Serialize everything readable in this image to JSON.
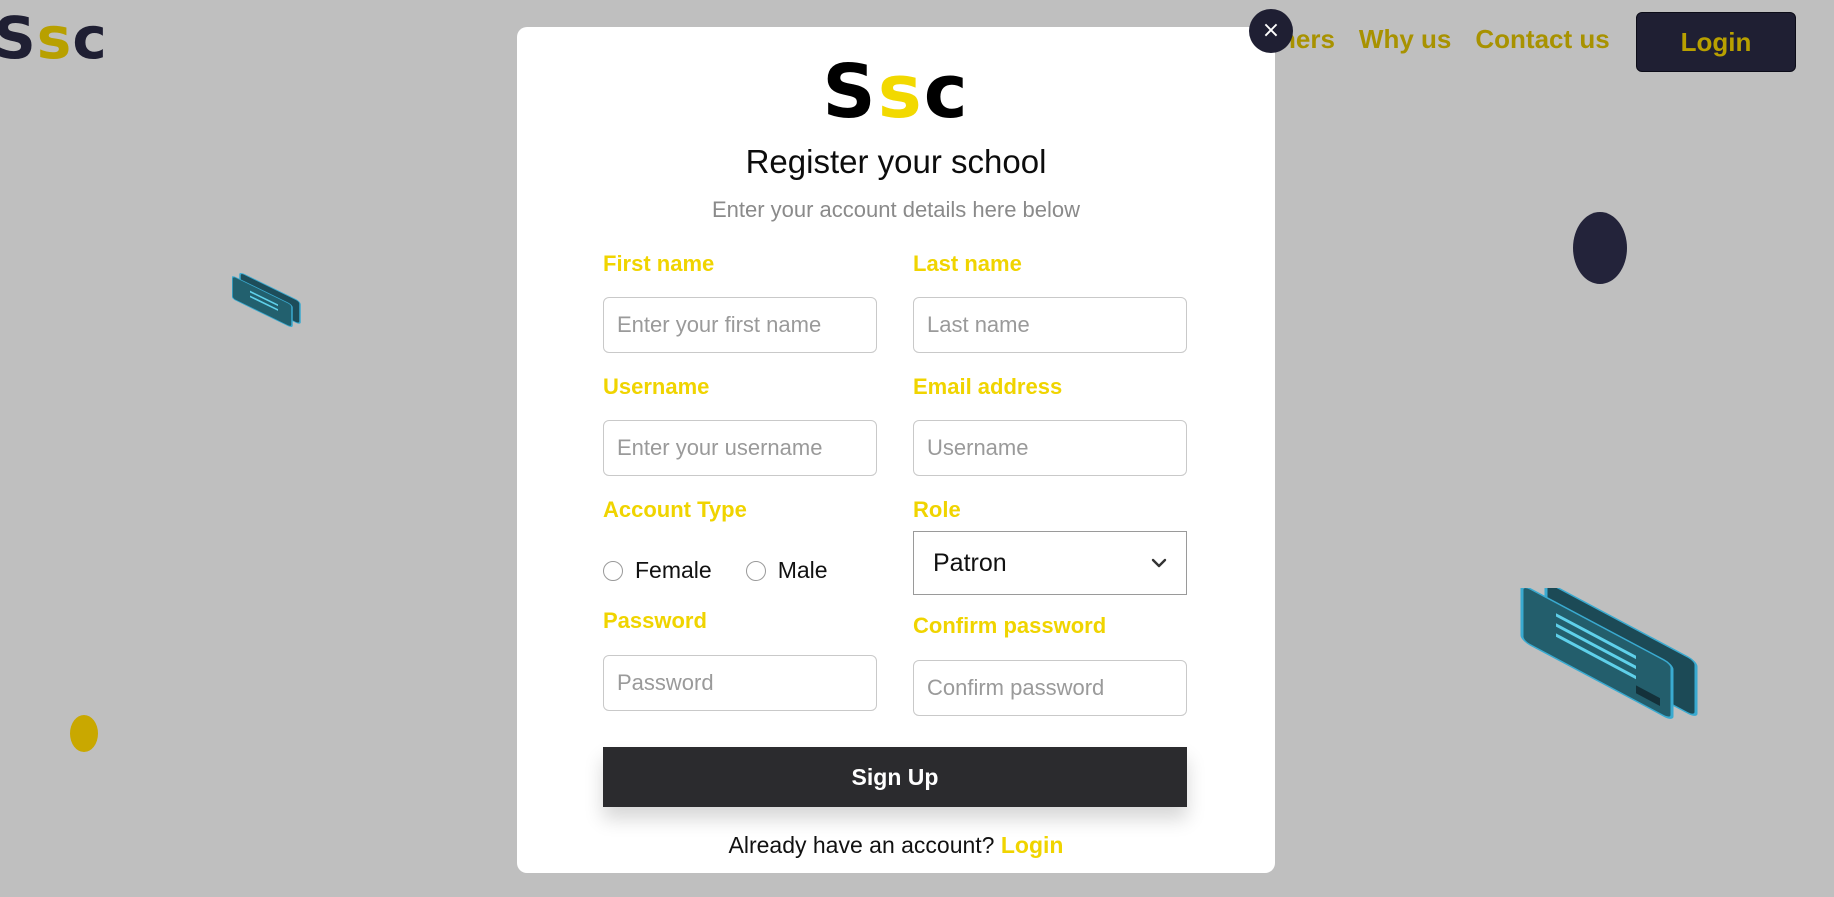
{
  "background": {
    "logo": {
      "part1": "S",
      "part2": "s",
      "part3": "c"
    },
    "nav": [
      {
        "label": "ners"
      },
      {
        "label": "Why us"
      },
      {
        "label": "Contact us"
      }
    ],
    "login_button": "Login"
  },
  "modal": {
    "close_icon": "×",
    "logo": {
      "part1": "S",
      "part2": "s",
      "part3": "c"
    },
    "title": "Register your school",
    "subtitle": "Enter your account details here below",
    "fields": {
      "first_name": {
        "label": "First name",
        "placeholder": "Enter your first name"
      },
      "last_name": {
        "label": "Last name",
        "placeholder": "Last name"
      },
      "username": {
        "label": "Username",
        "placeholder": "Enter your username"
      },
      "email": {
        "label": "Email address",
        "placeholder": "Username"
      },
      "account_type": {
        "label": "Account Type",
        "options": [
          "Female",
          "Male"
        ]
      },
      "role": {
        "label": "Role",
        "value": "Patron"
      },
      "password": {
        "label": "Password",
        "placeholder": "Password"
      },
      "confirm_password": {
        "label": "Confirm password",
        "placeholder": "Confirm password"
      }
    },
    "signup_button": "Sign Up",
    "footer": {
      "text": "Already have an account?",
      "link": "Login"
    }
  },
  "colors": {
    "accent_yellow": "#f0d400",
    "dark_navy": "#1f1f33",
    "button_dark": "#2b2b2e",
    "overlay_gray": "#bfbfbf"
  },
  "icons": [
    "close-icon",
    "chevron-down-icon",
    "credit-card-icon"
  ]
}
